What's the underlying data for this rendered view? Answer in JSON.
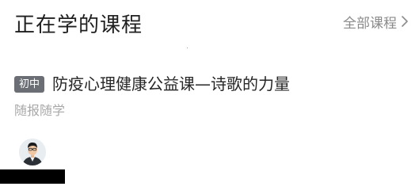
{
  "section": {
    "title": "正在学的课程",
    "all_link_label": "全部课程",
    "all_link_icon": "chevron-right-icon"
  },
  "course": {
    "level_badge": "初中",
    "title": "防疫心理健康公益课—诗歌的力量",
    "subtitle": "随报随学",
    "teacher_avatar_icon": "teacher-avatar"
  },
  "colors": {
    "badge_bg": "#6b6f75",
    "title_text": "#1f1f1f",
    "muted_text": "#a8a8a8",
    "link_text": "#8a8a8a"
  }
}
